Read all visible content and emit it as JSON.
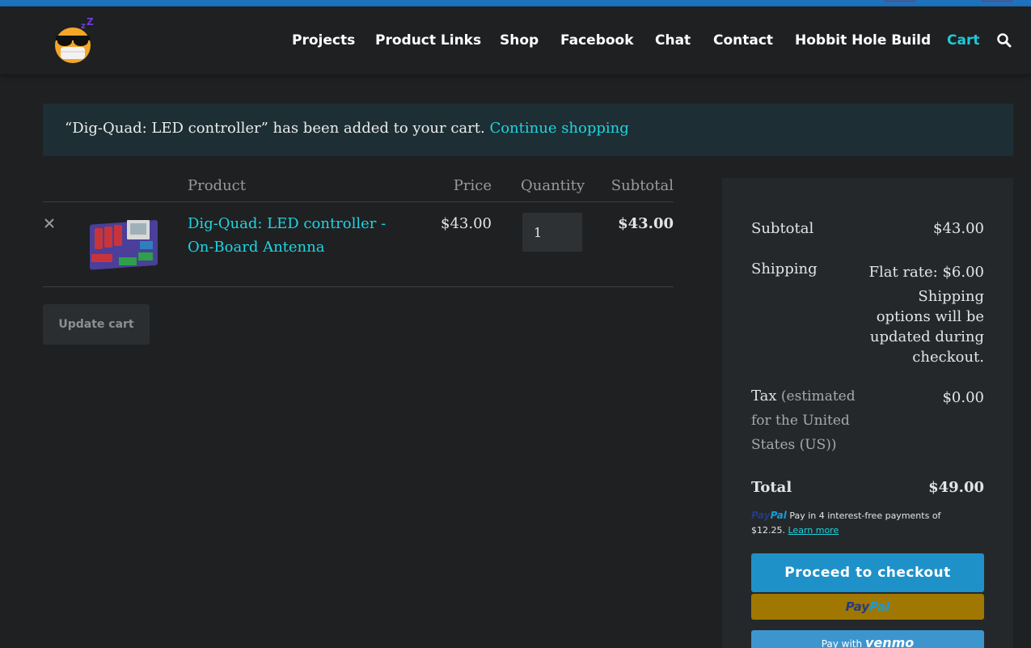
{
  "nav": {
    "items": [
      {
        "label": "Projects"
      },
      {
        "label": "Product Links"
      },
      {
        "label": "Shop"
      },
      {
        "label": "Facebook"
      },
      {
        "label": "Chat"
      },
      {
        "label": "Contact"
      },
      {
        "label": "Hobbit Hole Build"
      },
      {
        "label": "Cart",
        "active": true
      }
    ],
    "search_icon": "search-icon",
    "logo_icon": "sleepy-sunglasses-emoji-logo"
  },
  "notice": {
    "message": "“Dig-Quad: LED controller” has been added to your cart.",
    "link_label": "Continue shopping"
  },
  "cart": {
    "headers": {
      "product": "Product",
      "price": "Price",
      "quantity": "Quantity",
      "subtotal": "Subtotal"
    },
    "items": [
      {
        "name": "Dig-Quad: LED controller - On-Board Antenna",
        "price": "$43.00",
        "quantity": "1",
        "subtotal": "$43.00"
      }
    ],
    "update_label": "Update cart"
  },
  "totals": {
    "subtotal_label": "Subtotal",
    "subtotal_value": "$43.00",
    "shipping_label": "Shipping",
    "shipping_value": "Flat rate: $6.00",
    "shipping_note": "Shipping options will be updated during checkout.",
    "tax_label": "Tax",
    "tax_note": "(estimated for the United States (US))",
    "tax_value": "$0.00",
    "total_label": "Total",
    "total_value": "$49.00",
    "paylater_brand_a": "Pay",
    "paylater_brand_b": "Pal",
    "paylater_text": "Pay in 4 interest-free payments of $12.25.",
    "paylater_link": "Learn more",
    "checkout_label": "Proceed to checkout",
    "paypal_a": "Pay",
    "paypal_b": "Pal",
    "venmo_prefix": "Pay with",
    "venmo_brand": "venmo"
  },
  "colors": {
    "background": "#1e2022",
    "accent": "#1fd5e0",
    "checkout": "#1e91c8",
    "paypal": "#a07700",
    "venmo": "#3d95ce"
  }
}
